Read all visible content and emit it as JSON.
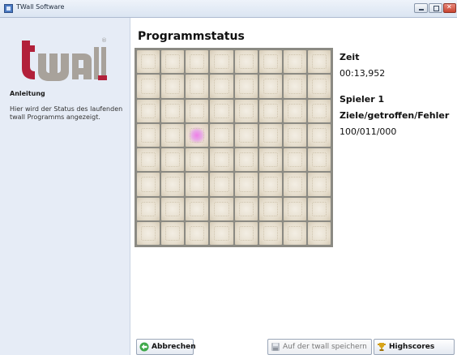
{
  "window": {
    "title": "TWall Software"
  },
  "sidebar": {
    "logo_text": "twall",
    "instructions_title": "Anleitung",
    "instructions_text": "Hier wird der Status des laufenden twall Programms angezeigt."
  },
  "main": {
    "title": "Programmstatus",
    "grid": {
      "rows": 8,
      "cols": 8,
      "lit_cell": {
        "row": 3,
        "col": 2
      },
      "lit_color": "#f07fe8"
    },
    "time_label": "Zeit",
    "time_value": "00:13,952",
    "player_label": "Spieler 1",
    "score_header": "Ziele/getroffen/Fehler",
    "score_value": "100/011/000"
  },
  "buttons": {
    "cancel": "Abbrechen",
    "save": "Auf der twall speichern",
    "highscores": "Highscores"
  },
  "icons": {
    "cancel": "back-arrow-icon",
    "save": "save-disk-icon",
    "highscores": "trophy-icon"
  },
  "colors": {
    "brand": "#b2203a",
    "sidebar_bg": "#e6ecf6",
    "accent": "#4a79c2"
  }
}
